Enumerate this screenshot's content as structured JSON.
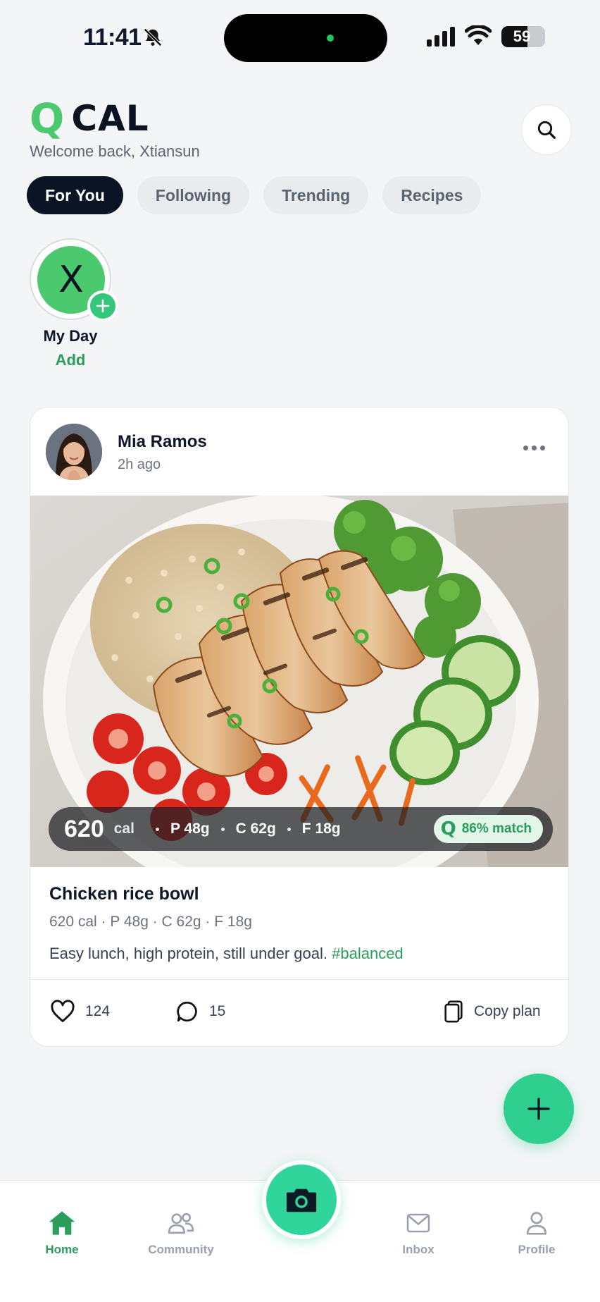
{
  "status_bar": {
    "time": "11:41",
    "battery": "59",
    "battery_level": 0.59,
    "icons": [
      "bell-mute-icon",
      "signal-icon",
      "wifi-icon",
      "battery-icon"
    ]
  },
  "header": {
    "logo_mark": "Q",
    "logo_text": "CAL",
    "welcome": "Welcome back, Xtiansun",
    "search_icon": "search-icon"
  },
  "tabs": [
    {
      "label": "For You",
      "active": true
    },
    {
      "label": "Following",
      "active": false
    },
    {
      "label": "Trending",
      "active": false
    },
    {
      "label": "Recipes",
      "active": false
    }
  ],
  "story": {
    "initial": "X",
    "name": "My Day",
    "action": "Add"
  },
  "post": {
    "author": "Mia Ramos",
    "time": "2h ago",
    "calories": "620",
    "cal_unit": "cal",
    "protein": "P 48g",
    "carbs": "C 62g",
    "fat": "F 18g",
    "match_mark": "Q",
    "match": "86% match",
    "title": "Chicken rice bowl",
    "macros_line": "620 cal · P 48g · C 62g · F 18g",
    "caption": "Easy lunch, high protein, still under goal. ",
    "hashtag": "#balanced",
    "likes": "124",
    "comments": "15",
    "copy_label": "Copy plan"
  },
  "nav": {
    "items": [
      {
        "label": "Home",
        "icon": "home-icon",
        "active": true
      },
      {
        "label": "Community",
        "icon": "community-icon",
        "active": false
      },
      {
        "label": "Inbox",
        "icon": "mail-icon",
        "active": false
      },
      {
        "label": "Profile",
        "icon": "user-icon",
        "active": false
      }
    ],
    "center_icon": "camera-icon"
  },
  "colors": {
    "accent": "#2fcf90",
    "brand_green": "#4cc96f",
    "dark": "#0b1424"
  }
}
